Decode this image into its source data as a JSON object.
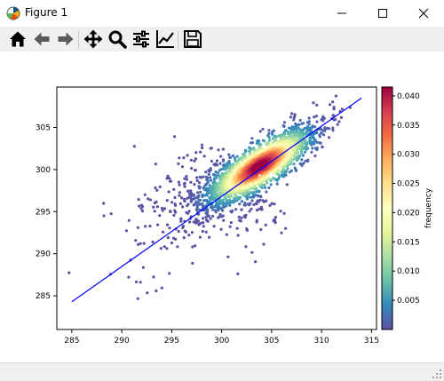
{
  "window": {
    "title": "Figure 1"
  },
  "toolbar": {
    "buttons": [
      {
        "name": "home-button",
        "icon": "home-icon"
      },
      {
        "name": "back-button",
        "icon": "arrow-left-icon"
      },
      {
        "name": "forward-button",
        "icon": "arrow-right-icon"
      },
      {
        "name": "pan-button",
        "icon": "move-icon"
      },
      {
        "name": "zoom-button",
        "icon": "magnifier-icon"
      },
      {
        "name": "configure-subplots-button",
        "icon": "sliders-icon"
      },
      {
        "name": "edit-axis-button",
        "icon": "line-chart-icon"
      },
      {
        "name": "save-button",
        "icon": "floppy-disk-icon"
      }
    ]
  },
  "chart_data": {
    "type": "scatter",
    "xlim": [
      283.5,
      315.5
    ],
    "ylim": [
      281.0,
      309.8
    ],
    "x_ticks": [
      285,
      290,
      295,
      300,
      305,
      310,
      315
    ],
    "x_tick_labels": [
      "285",
      "290",
      "295",
      "300",
      "305",
      "310",
      "315"
    ],
    "y_ticks": [
      285,
      290,
      295,
      300,
      305
    ],
    "y_tick_labels": [
      "285",
      "290",
      "295",
      "300",
      "305"
    ],
    "grid": false,
    "density_cloud": {
      "center": [
        303.8,
        300.4
      ],
      "axis_1_direction": [
        1.0,
        0.82
      ],
      "std_axis_1": 3.6,
      "std_axis_2": 1.0,
      "count": 2600,
      "tail_fraction": 0.15
    },
    "fit_line": {
      "x": [
        285,
        314
      ],
      "y": [
        284.3,
        308.5
      ],
      "color": "#0000ff"
    },
    "colormap": "Spectral_r",
    "colorbar": {
      "label": "frequency",
      "vmin": 0.0,
      "vmax": 0.0415,
      "ticks": [
        0.005,
        0.01,
        0.015,
        0.02,
        0.025,
        0.03,
        0.035,
        0.04
      ],
      "tick_labels": [
        "0.005",
        "0.010",
        "0.015",
        "0.020",
        "0.025",
        "0.030",
        "0.035",
        "0.040"
      ]
    }
  }
}
